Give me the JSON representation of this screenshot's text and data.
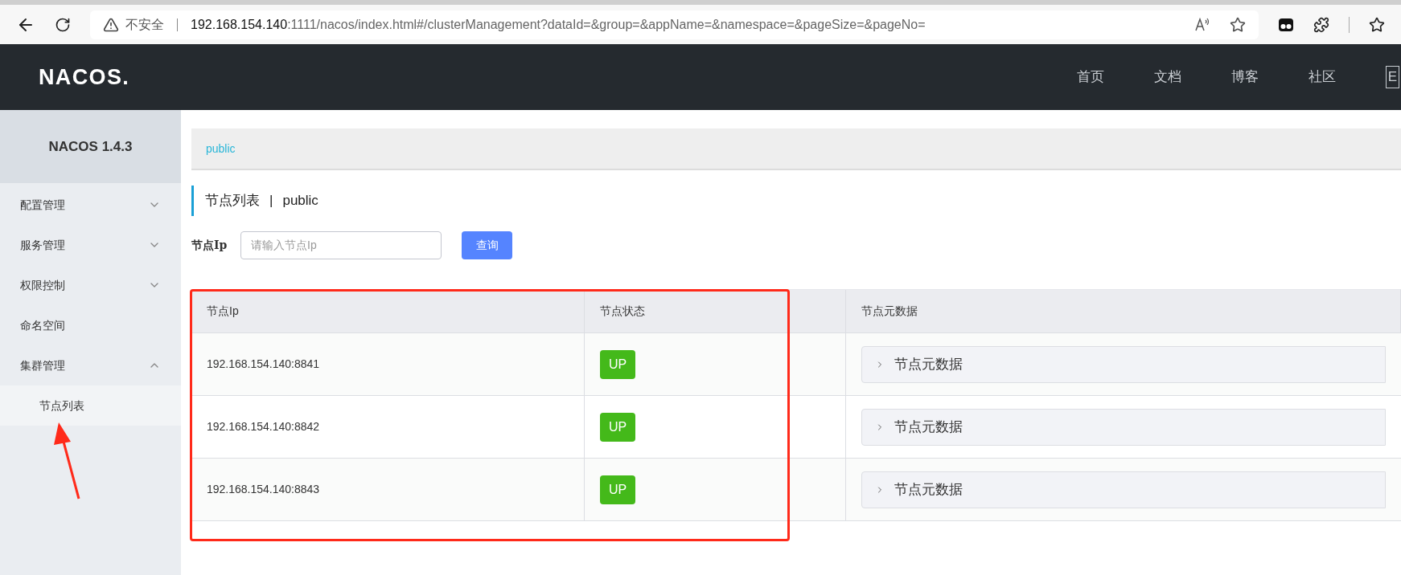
{
  "browser": {
    "security": "不安全",
    "url_host": "192.168.154.140",
    "url_rest": ":1111/nacos/index.html#/clusterManagement?dataId=&group=&appName=&namespace=&pageSize=&pageNo="
  },
  "header": {
    "logo": "NACOS.",
    "nav": [
      "首页",
      "文档",
      "博客",
      "社区"
    ],
    "lang": "E"
  },
  "sidebar": {
    "title": "NACOS 1.4.3",
    "items": [
      {
        "label": "配置管理",
        "expanded": false
      },
      {
        "label": "服务管理",
        "expanded": false
      },
      {
        "label": "权限控制",
        "expanded": false
      },
      {
        "label": "命名空间"
      },
      {
        "label": "集群管理",
        "expanded": true,
        "children": [
          {
            "label": "节点列表",
            "selected": true
          }
        ]
      }
    ]
  },
  "namespace_bar": {
    "items": [
      {
        "label": "public",
        "selected": true
      }
    ]
  },
  "page_title": {
    "title": "节点列表",
    "separator": "|",
    "namespace": "public"
  },
  "search": {
    "label": "节点Ip",
    "placeholder": "请输入节点Ip",
    "button": "查询"
  },
  "table": {
    "columns": [
      "节点Ip",
      "节点状态",
      "节点元数据"
    ],
    "rows": [
      {
        "ip": "192.168.154.140:8841",
        "status": "UP",
        "metadata": "节点元数据"
      },
      {
        "ip": "192.168.154.140:8842",
        "status": "UP",
        "metadata": "节点元数据"
      },
      {
        "ip": "192.168.154.140:8843",
        "status": "UP",
        "metadata": "节点元数据"
      }
    ]
  }
}
